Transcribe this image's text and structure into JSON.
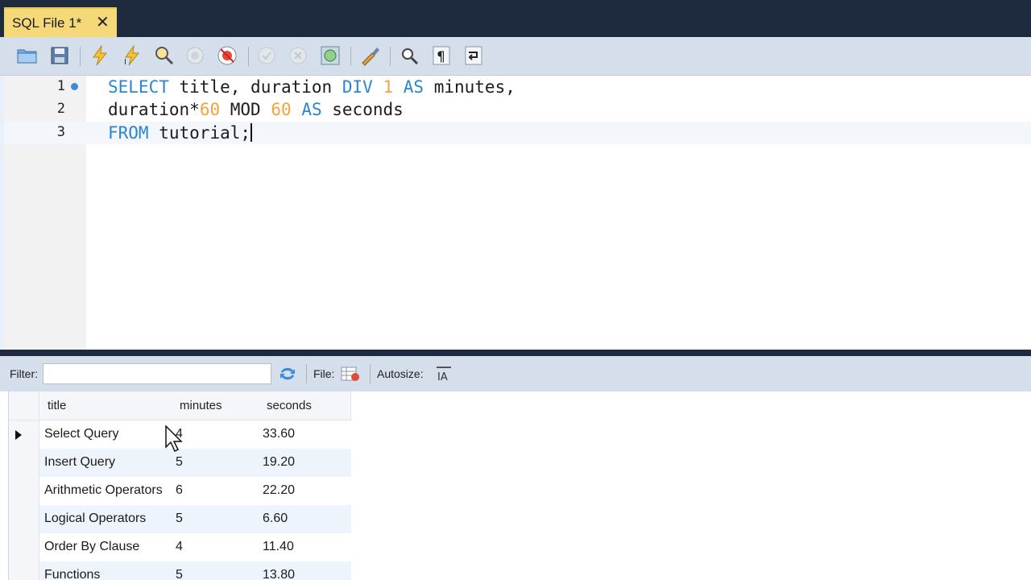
{
  "tab": {
    "label": "SQL File 1*",
    "close": "✕"
  },
  "toolbar": {
    "icons": [
      "open-file",
      "save",
      "execute",
      "execute-current",
      "explain",
      "stop",
      "toggle-stop-on-error",
      "commit",
      "rollback",
      "autocommit",
      "beautify",
      "find",
      "invisible-chars",
      "wrap-lines"
    ]
  },
  "editor": {
    "lines": [
      {
        "number": "1",
        "has_marker": true,
        "text": "SELECT title, duration DIV 1 AS minutes,"
      },
      {
        "number": "2",
        "has_marker": false,
        "text": "duration*60 MOD 60 AS seconds"
      },
      {
        "number": "3",
        "has_marker": false,
        "text": "FROM tutorial;"
      }
    ],
    "colors": {
      "keyword": "#2b84d4",
      "number": "#f2a33c"
    }
  },
  "results_toolbar": {
    "filter_label": "Filter:",
    "filter_value": "",
    "file_label": "File:",
    "autosize_label": "Autosize:",
    "autosize_icon_text": "IA"
  },
  "grid": {
    "columns": [
      "title",
      "minutes",
      "seconds"
    ],
    "rows": [
      {
        "title": "Select Query",
        "minutes": "4",
        "seconds": "33.60",
        "selected": true
      },
      {
        "title": "Insert Query",
        "minutes": "5",
        "seconds": "19.20",
        "selected": false
      },
      {
        "title": "Arithmetic Operators",
        "minutes": "6",
        "seconds": "22.20",
        "selected": false
      },
      {
        "title": "Logical Operators",
        "minutes": "5",
        "seconds": "6.60",
        "selected": false
      },
      {
        "title": "Order By Clause",
        "minutes": "4",
        "seconds": "11.40",
        "selected": false
      },
      {
        "title": "Functions",
        "minutes": "5",
        "seconds": "13.80",
        "selected": false
      }
    ]
  }
}
